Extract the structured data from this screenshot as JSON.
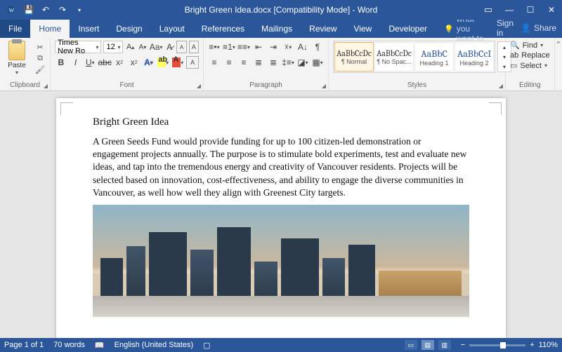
{
  "titlebar": {
    "document_title": "Bright Green Idea.docx [Compatibility Mode] - Word"
  },
  "tabs": {
    "file": "File",
    "home": "Home",
    "insert": "Insert",
    "design": "Design",
    "layout": "Layout",
    "references": "References",
    "mailings": "Mailings",
    "review": "Review",
    "view": "View",
    "developer": "Developer",
    "tell_me": "Tell me what you want to do...",
    "sign_in": "Sign in",
    "share": "Share"
  },
  "ribbon": {
    "clipboard": {
      "paste": "Paste",
      "label": "Clipboard"
    },
    "font": {
      "name": "Times New Ro",
      "size": "12",
      "label": "Font"
    },
    "paragraph": {
      "label": "Paragraph"
    },
    "styles": {
      "label": "Styles",
      "items": [
        {
          "preview": "AaBbCcDc",
          "name": "¶ Normal"
        },
        {
          "preview": "AaBbCcDc",
          "name": "¶ No Spac..."
        },
        {
          "preview": "AaBbC",
          "name": "Heading 1"
        },
        {
          "preview": "AaBbCcI",
          "name": "Heading 2"
        }
      ]
    },
    "editing": {
      "find": "Find",
      "replace": "Replace",
      "select": "Select",
      "label": "Editing"
    }
  },
  "document": {
    "title": "Bright Green Idea",
    "body": "A Green Seeds Fund would provide funding for up to 100 citizen-led demonstration or engagement projects annually. The purpose is to stimulate bold experiments, test and evaluate new ideas, and tap into the tremendous energy and creativity of Vancouver residents. Projects will be selected based on innovation, cost-effectiveness, and ability to engage the diverse communities in Vancouver, as well how well they align with Greenest City targets."
  },
  "status": {
    "page": "Page 1 of 1",
    "words": "70 words",
    "language": "English (United States)",
    "zoom": "110%"
  }
}
